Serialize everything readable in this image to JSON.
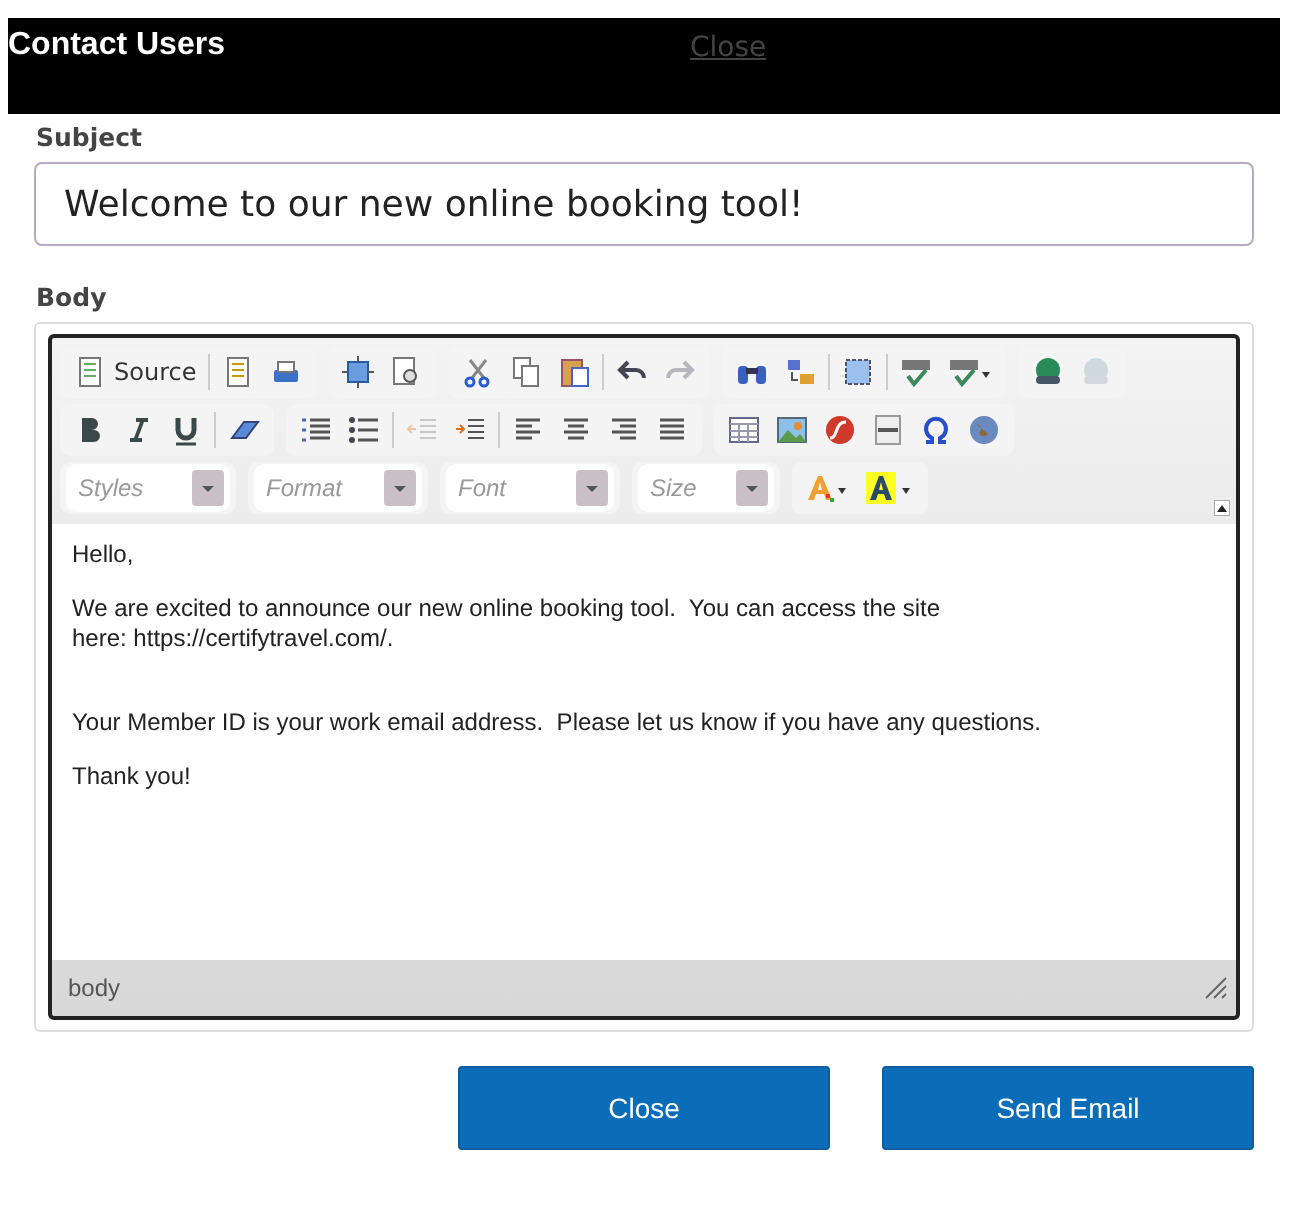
{
  "dialog": {
    "title": "Contact Users",
    "close_link": "Close"
  },
  "subject": {
    "label": "Subject",
    "value": "Welcome to our new online booking tool!"
  },
  "body": {
    "label": "Body",
    "toolbar_rows": [
      [
        [
          [
            {
              "kind": "source",
              "label": "Source",
              "disabled": false
            }
          ],
          [
            {
              "kind": "newpage",
              "disabled": false
            },
            {
              "kind": "print",
              "disabled": false
            }
          ]
        ],
        [
          [
            {
              "kind": "maximize",
              "disabled": false
            },
            {
              "kind": "preview",
              "disabled": false
            }
          ]
        ],
        [
          [
            {
              "kind": "cut",
              "disabled": false
            },
            {
              "kind": "copy",
              "disabled": false
            },
            {
              "kind": "paste",
              "disabled": false
            }
          ],
          [
            {
              "kind": "undo",
              "disabled": false
            },
            {
              "kind": "redo",
              "disabled": true
            }
          ]
        ],
        [
          [
            {
              "kind": "find",
              "disabled": false
            },
            {
              "kind": "replace",
              "disabled": false
            }
          ],
          [
            {
              "kind": "selectall",
              "disabled": false
            }
          ],
          [
            {
              "kind": "spell",
              "disabled": false
            },
            {
              "kind": "spellmenu",
              "disabled": false
            }
          ]
        ],
        [
          [
            {
              "kind": "link",
              "disabled": false
            },
            {
              "kind": "unlink",
              "disabled": true
            }
          ]
        ]
      ],
      [
        [
          [
            {
              "kind": "bold",
              "disabled": false
            },
            {
              "kind": "italic",
              "disabled": false
            },
            {
              "kind": "underline",
              "disabled": false
            }
          ],
          [
            {
              "kind": "eraser",
              "disabled": false
            }
          ]
        ],
        [
          [
            {
              "kind": "ol",
              "disabled": false
            },
            {
              "kind": "ul",
              "disabled": false
            }
          ],
          [
            {
              "kind": "outdent",
              "disabled": true
            },
            {
              "kind": "indent",
              "disabled": false
            }
          ],
          [
            {
              "kind": "left",
              "disabled": false
            },
            {
              "kind": "center",
              "disabled": false
            },
            {
              "kind": "right",
              "disabled": false
            },
            {
              "kind": "justify",
              "disabled": false
            }
          ]
        ],
        [
          [
            {
              "kind": "table",
              "disabled": false
            },
            {
              "kind": "image",
              "disabled": false
            },
            {
              "kind": "flash",
              "disabled": false
            },
            {
              "kind": "hr",
              "disabled": false
            },
            {
              "kind": "omega",
              "disabled": false
            },
            {
              "kind": "globe",
              "disabled": false
            }
          ]
        ]
      ]
    ],
    "combos": [
      {
        "placeholder": "Styles"
      },
      {
        "placeholder": "Format"
      },
      {
        "placeholder": "Font"
      },
      {
        "placeholder": "Size"
      }
    ],
    "paragraphs": [
      [
        "Hello,"
      ],
      [
        "We are excited to announce our new online booking tool.  You can access the site",
        "here: https://certifytravel.com/."
      ],
      [
        "Your Member ID is your work email address.  Please let us know if you have any questions."
      ],
      [
        "Thank you!"
      ]
    ],
    "status_path": "body"
  },
  "buttons": [
    {
      "label": "Close"
    },
    {
      "label": "Send Email"
    }
  ]
}
